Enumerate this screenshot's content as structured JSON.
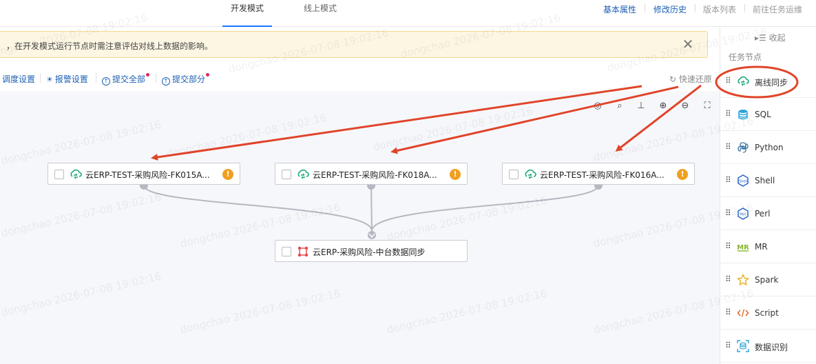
{
  "top_tabs": [
    {
      "label": "开发模式",
      "active": true
    },
    {
      "label": "线上模式",
      "active": false
    }
  ],
  "top_links": [
    "基本属性",
    "修改历史",
    "版本列表",
    "前往任务运维"
  ],
  "banner": {
    "text": "，在开发模式运行节点时需注意评估对线上数据的影响。"
  },
  "toolbar": {
    "schedule": "调度设置",
    "alarm": "报警设置",
    "submit_all": "提交全部",
    "submit_part": "提交部分",
    "restore": "快速还原"
  },
  "nodes": [
    {
      "label": "云ERP-TEST-采购风险-FK015A...",
      "type": "offline-sync",
      "warning": "!"
    },
    {
      "label": "云ERP-TEST-采购风险-FK018A...",
      "type": "offline-sync",
      "warning": "!"
    },
    {
      "label": "云ERP-TEST-采购风险-FK016A...",
      "type": "offline-sync",
      "warning": "!"
    },
    {
      "label": "云ERP-采购风险-中台数据同步",
      "type": "virtual",
      "warning": ""
    }
  ],
  "panel": {
    "collapse": "收起",
    "title": "任务节点",
    "items": [
      {
        "label": "离线同步",
        "icon": "cloud-sync-icon"
      },
      {
        "label": "SQL",
        "icon": "database-icon"
      },
      {
        "label": "Python",
        "icon": "python-icon"
      },
      {
        "label": "Shell",
        "icon": "shell-icon"
      },
      {
        "label": "Perl",
        "icon": "perl-icon"
      },
      {
        "label": "MR",
        "icon": "mr-icon"
      },
      {
        "label": "Spark",
        "icon": "star-icon"
      },
      {
        "label": "Script",
        "icon": "code-icon"
      },
      {
        "label": "数据识别",
        "icon": "data-recognition-icon"
      }
    ]
  },
  "watermark": "dongchao 2026-07-08 19:02:16",
  "colors": {
    "accent": "#1677ff",
    "link": "#1a5fb4",
    "annotation": "#e0442a",
    "sync_icon": "#19a974",
    "warning": "#f0a020"
  }
}
